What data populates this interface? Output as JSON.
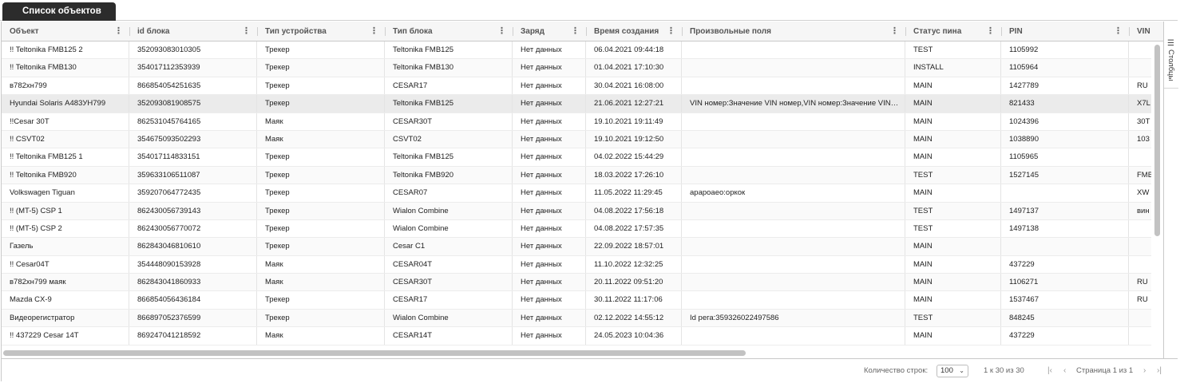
{
  "tab": {
    "label": "Список объектов"
  },
  "columns": [
    {
      "label": "Объект",
      "menu": true
    },
    {
      "label": "id блока",
      "menu": true
    },
    {
      "label": "Тип устройства",
      "menu": true
    },
    {
      "label": "Тип блока",
      "menu": true
    },
    {
      "label": "Заряд",
      "menu": true
    },
    {
      "label": "Время создания",
      "menu": true
    },
    {
      "label": "Произвольные поля",
      "menu": true
    },
    {
      "label": "Статус пина",
      "menu": true
    },
    {
      "label": "PIN",
      "menu": true
    },
    {
      "label": "VIN",
      "menu": false
    }
  ],
  "rows": [
    [
      "!! Teltonika FMB125 2",
      "352093083010305",
      "Трекер",
      "Teltonika FMB125",
      "Нет данных",
      "06.04.2021 09:44:18",
      "",
      "TEST",
      "1105992",
      ""
    ],
    [
      "!! Teltonika FMB130",
      "354017112353939",
      "Трекер",
      "Teltonika FMB130",
      "Нет данных",
      "01.04.2021 17:10:30",
      "",
      "INSTALL",
      "1105964",
      ""
    ],
    [
      "в782хн799",
      "866854054251635",
      "Трекер",
      "CESAR17",
      "Нет данных",
      "30.04.2021 16:08:00",
      "",
      "MAIN",
      "1427789",
      "RU"
    ],
    [
      "Hyundai Solaris А483УН799",
      "352093081908575",
      "Трекер",
      "Teltonika FMB125",
      "Нет данных",
      "21.06.2021 12:27:21",
      "VIN номер:Значение VIN номер,VIN номер:Значение VIN номер",
      "MAIN",
      "821433",
      "X7L"
    ],
    [
      "!!Cesar 30T",
      "862531045764165",
      "Маяк",
      "CESAR30T",
      "Нет данных",
      "19.10.2021 19:11:49",
      "",
      "MAIN",
      "1024396",
      "30T"
    ],
    [
      "!! CSVT02",
      "354675093502293",
      "Маяк",
      "CSVT02",
      "Нет данных",
      "19.10.2021 19:12:50",
      "",
      "MAIN",
      "1038890",
      "103"
    ],
    [
      "!! Teltonika FMB125 1",
      "354017114833151",
      "Трекер",
      "Teltonika FMB125",
      "Нет данных",
      "04.02.2022 15:44:29",
      "",
      "MAIN",
      "1105965",
      ""
    ],
    [
      "!! Teltonika FMB920",
      "359633106511087",
      "Трекер",
      "Teltonika FMB920",
      "Нет данных",
      "18.03.2022 17:26:10",
      "",
      "TEST",
      "1527145",
      "FMB"
    ],
    [
      "Volkswagen Tiguan",
      "359207064772435",
      "Трекер",
      "CESAR07",
      "Нет данных",
      "11.05.2022 11:29:45",
      "арароаео:оркок",
      "MAIN",
      "",
      "XW"
    ],
    [
      "!! (MT-5) CSP 1",
      "862430056739143",
      "Трекер",
      "Wialon Combine",
      "Нет данных",
      "04.08.2022 17:56:18",
      "",
      "TEST",
      "1497137",
      "вин"
    ],
    [
      "!! (MT-5) CSP 2",
      "862430056770072",
      "Трекер",
      "Wialon Combine",
      "Нет данных",
      "04.08.2022 17:57:35",
      "",
      "TEST",
      "1497138",
      ""
    ],
    [
      "Газель",
      "862843046810610",
      "Трекер",
      "Cesar C1",
      "Нет данных",
      "22.09.2022 18:57:01",
      "",
      "MAIN",
      "",
      ""
    ],
    [
      "!! Cesar04T",
      "354448090153928",
      "Маяк",
      "CESAR04T",
      "Нет данных",
      "11.10.2022 12:32:25",
      "",
      "MAIN",
      "437229",
      ""
    ],
    [
      "в782хн799 маяк",
      "862843041860933",
      "Маяк",
      "CESAR30T",
      "Нет данных",
      "20.11.2022 09:51:20",
      "",
      "MAIN",
      "1106271",
      "RU"
    ],
    [
      "Mazda CX-9",
      "866854056436184",
      "Трекер",
      "CESAR17",
      "Нет данных",
      "30.11.2022 11:17:06",
      "",
      "MAIN",
      "1537467",
      "RU"
    ],
    [
      "Видеорегистратор",
      "866897052376599",
      "Трекер",
      "Wialon Combine",
      "Нет данных",
      "02.12.2022 14:55:12",
      "Id рега:359326022497586",
      "TEST",
      "848245",
      ""
    ],
    [
      "!! 437229 Cesar 14T",
      "869247041218592",
      "Маяк",
      "CESAR14T",
      "Нет данных",
      "24.05.2023 10:04:36",
      "",
      "MAIN",
      "437229",
      ""
    ]
  ],
  "selected_row": 3,
  "sidebar": {
    "columns_label": "Столбцы"
  },
  "footer": {
    "rows_per_page_label": "Количество строк:",
    "rows_per_page_value": "100",
    "range_text": "1 к 30 из 30",
    "page_text": "Страница 1 из 1"
  },
  "icons": {
    "column_menu": "vertical-dots-icon",
    "columns_panel": "columns-icon",
    "first_page": "first-page-icon",
    "prev_page": "prev-page-icon",
    "next_page": "next-page-icon",
    "last_page": "last-page-icon"
  }
}
